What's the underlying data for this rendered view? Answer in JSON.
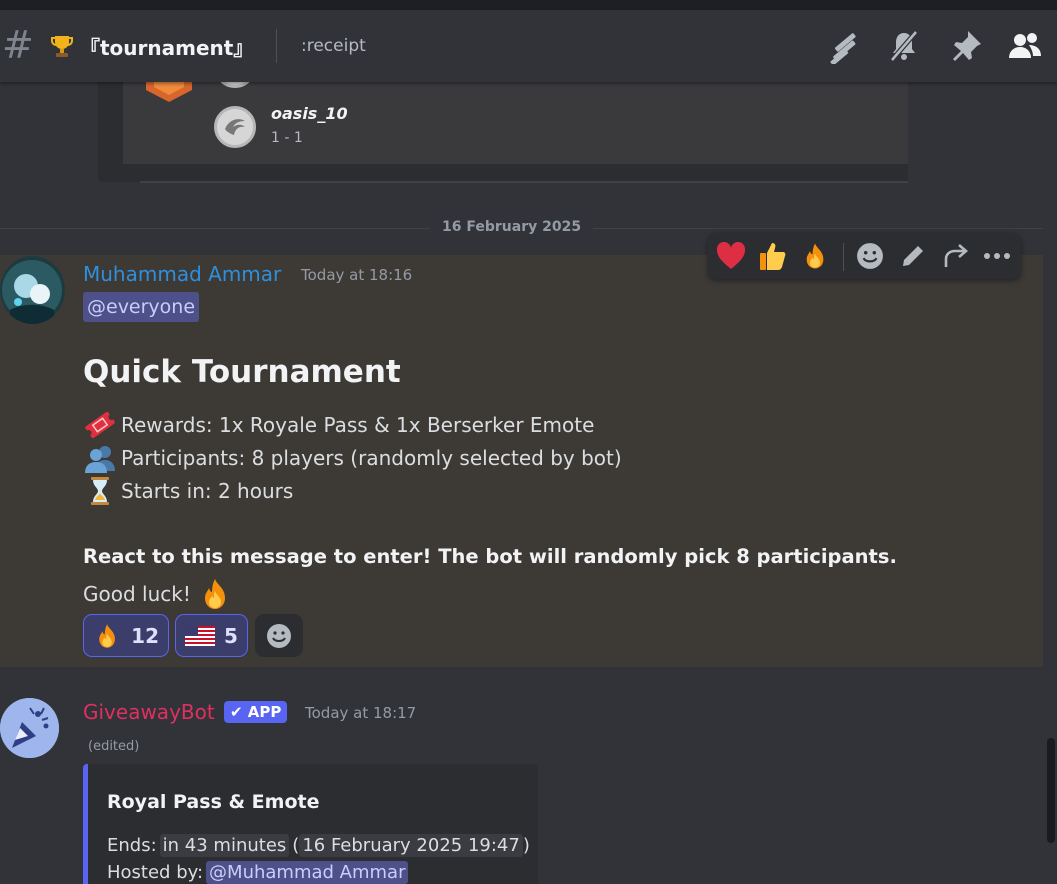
{
  "header": {
    "channel_name": "『tournament』",
    "topic": ":receipt",
    "icons": [
      "threads-icon",
      "mute-bell-icon",
      "pin-icon",
      "members-icon"
    ]
  },
  "previous_embed": {
    "player_name": "oasis_10",
    "player_score": "1 - 1"
  },
  "date_divider": "16 February 2025",
  "message1": {
    "author": "Muhammad Ammar",
    "author_color": "#2f8fdc",
    "timestamp": "Today at 18:16",
    "mention": "@everyone",
    "heading": "Quick Tournament",
    "lines": [
      {
        "icon": "ticket-emoji",
        "text": "Rewards: 1x Royale Pass & 1x Berserker Emote"
      },
      {
        "icon": "busts-emoji",
        "text": "Participants: 8 players (randomly selected by bot)"
      },
      {
        "icon": "hourglass-emoji",
        "text": "Starts in: 2 hours"
      }
    ],
    "bold_text": "React to this message to enter! The bot will randomly pick 8 participants.",
    "closing_text": "Good luck!",
    "reactions": [
      {
        "emoji": "fire-emoji",
        "count": "12"
      },
      {
        "emoji": "us-flag-emoji",
        "count": "5"
      }
    ]
  },
  "hover_toolbar": {
    "items": [
      "heart-emoji",
      "thumbs-up-emoji",
      "fire-emoji",
      "add-reaction-icon",
      "edit-icon",
      "forward-icon",
      "more-icon"
    ]
  },
  "message2": {
    "author": "GiveawayBot",
    "author_color": "#e0305f",
    "badge": "APP",
    "timestamp": "Today at 18:17",
    "edited": "(edited)",
    "embed": {
      "title": "Royal Pass & Emote",
      "ends_label": "Ends:",
      "ends_relative": "in 43 minutes",
      "ends_absolute": "16 February 2025 19:47",
      "hosted_label": "Hosted by:",
      "hosted_by": "@Muhammad Ammar",
      "accent_color": "#5865f2"
    }
  },
  "colors": {
    "background": "#313338",
    "highlight": "#3d3a36",
    "mention_bg": "#4e5189",
    "blurple": "#5865f2"
  }
}
